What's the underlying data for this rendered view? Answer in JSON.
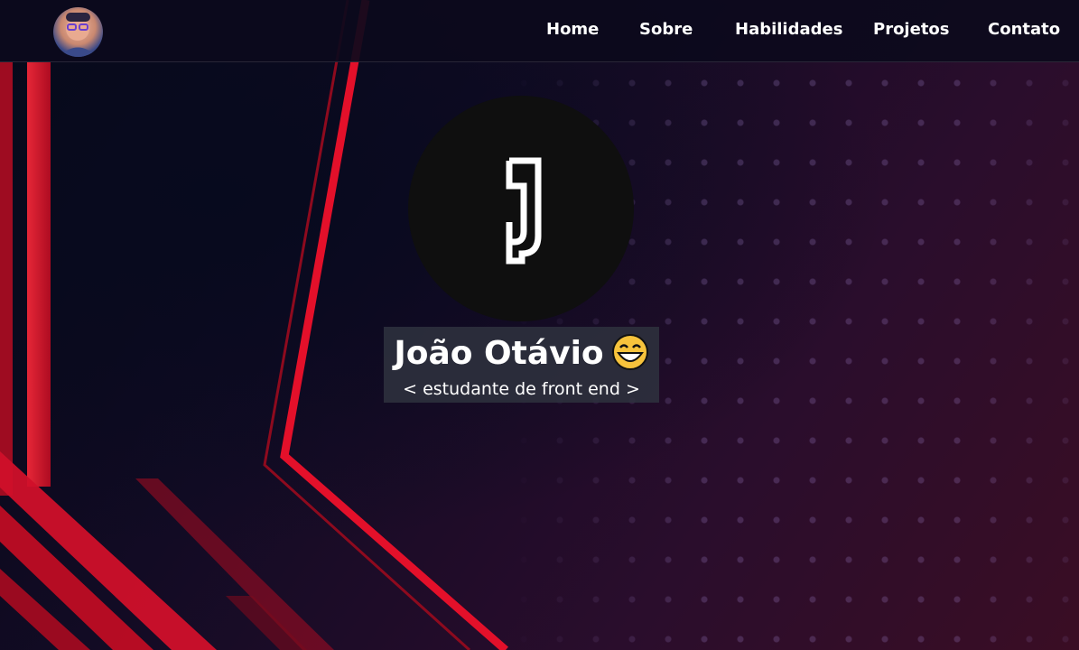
{
  "nav": {
    "avatar_alt": "profile-photo",
    "links": [
      "Home",
      "Sobre",
      "Habilidades",
      "Projetos",
      "Contato"
    ]
  },
  "hero": {
    "logo_letter": "J",
    "name": "João Otávio",
    "emoji": "grinning-face-icon",
    "tagline": "< estudante de front end >"
  },
  "colors": {
    "navbar_bg": "#0c0a1c",
    "accent_red": "#e3102a",
    "logo_bg": "#0f0f0f",
    "name_box_bg": "#2e313e",
    "text": "#ffffff"
  }
}
